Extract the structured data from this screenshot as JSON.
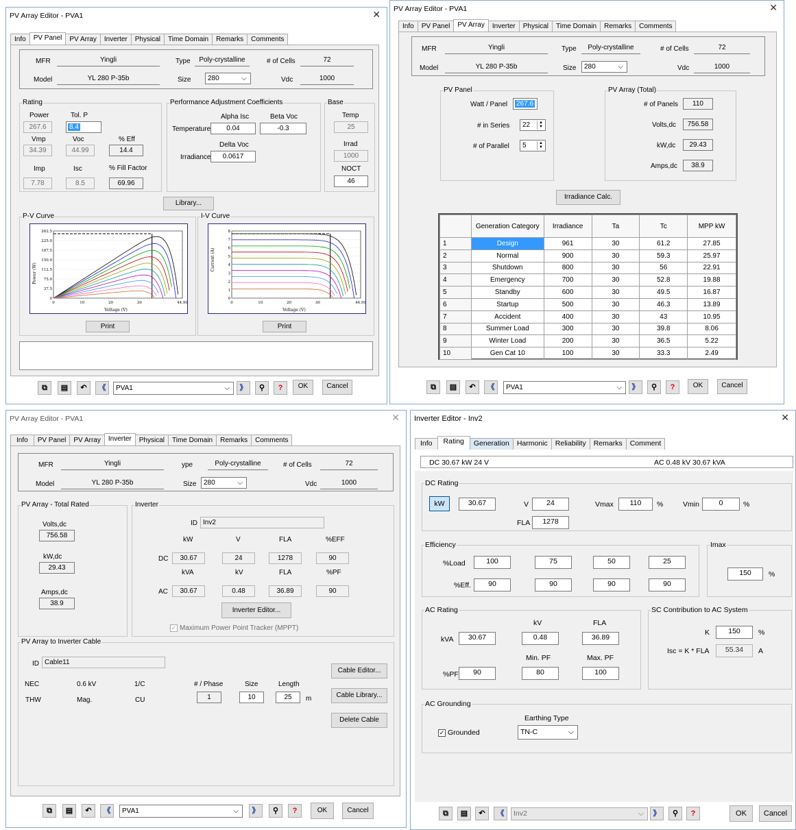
{
  "common": {
    "panel_tabs": [
      "Info",
      "PV Panel",
      "PV Array",
      "Inverter",
      "Physical",
      "Time Domain",
      "Remarks",
      "Comments"
    ],
    "close_symbol": "✕",
    "ok_label": "OK",
    "cancel_label": "Cancel",
    "pva_selector_value": "PVA1",
    "mfr_label": "MFR",
    "model_label": "Model",
    "type_label": "Type",
    "size_label": "Size",
    "cells_label": "# of Cells",
    "vdc_label": "Vdc",
    "mfr_value": "Yingli",
    "model_value": "YL 280 P-35b",
    "type_value": "Poly-crystalline",
    "size_value": "280",
    "cells_value": "72",
    "vdc_value": "1000"
  },
  "pv_panel_window": {
    "title": "PV Array Editor - PVA1",
    "active_tab": "PV Panel",
    "rating": {
      "group_label": "Rating",
      "power_label": "Power",
      "power_value": "267.6",
      "tolp_label": "Tol. P",
      "tolp_value": "8.4",
      "vmp_label": "Vmp",
      "vmp_value": "34.39",
      "voc_label": "Voc",
      "voc_value": "44.99",
      "eff_label": "% Eff",
      "eff_value": "14.4",
      "imp_label": "Imp",
      "imp_value": "7.78",
      "isc_label": "Isc",
      "isc_value": "8.5",
      "fill_label": "% Fill Factor",
      "fill_value": "69.96"
    },
    "pac": {
      "group_label": "Performance Adjustment Coefficients",
      "alpha_label": "Alpha Isc",
      "beta_label": "Beta Voc",
      "temperature_label": "Temperature",
      "alpha_value": "0.04",
      "beta_value": "-0.3",
      "delta_label": "Delta Voc",
      "irradiance_label": "Irradiance",
      "delta_value": "0.0617"
    },
    "base": {
      "group_label": "Base",
      "temp_label": "Temp",
      "temp_value": "25",
      "irrad_label": "Irrad",
      "irrad_value": "1000",
      "noct_label": "NOCT",
      "noct_value": "46"
    },
    "library_button": "Library...",
    "pv_curve": {
      "group_label": "P-V Curve",
      "y_label": "Power (W)",
      "x_label": "Voltage (V)",
      "y_ticks": [
        "262.5",
        "225.0",
        "187.5",
        "150.0",
        "112.5",
        "75.0",
        "37.5",
        "0"
      ],
      "x_ticks": [
        "0",
        "10",
        "20",
        "30",
        "44.99"
      ],
      "print_label": "Print"
    },
    "iv_curve": {
      "group_label": "I-V Curve",
      "y_label": "Current (A)",
      "x_label": "Voltage (V)",
      "y_ticks": [
        "8",
        "7",
        "6",
        "5",
        "4",
        "3",
        "2",
        "1",
        "0"
      ],
      "x_ticks": [
        "0",
        "10",
        "20",
        "30",
        "44.99"
      ],
      "print_label": "Print"
    }
  },
  "pv_array_window": {
    "title": "PV Array Editor - PVA1",
    "active_tab": "PV Array",
    "pv_panel": {
      "group_label": "PV Panel",
      "watt_label": "Watt / Panel",
      "watt_value": "267.6",
      "series_label": "# in Series",
      "series_value": "22",
      "parallel_label": "# of Parallel",
      "parallel_value": "5"
    },
    "pv_array_total": {
      "group_label": "PV Array (Total)",
      "panels_label": "# of Panels",
      "panels_value": "110",
      "volts_label": "Volts,dc",
      "volts_value": "756.58",
      "kw_label": "kW,dc",
      "kw_value": "29.43",
      "amps_label": "Amps,dc",
      "amps_value": "38.9"
    },
    "irradiance_button": "Irradiance Calc.",
    "table": {
      "columns": [
        "",
        "Generation Category",
        "Irradiance",
        "Ta",
        "Tc",
        "MPP kW"
      ],
      "rows": [
        [
          "1",
          "Design",
          "961",
          "30",
          "61.2",
          "27.85"
        ],
        [
          "2",
          "Normal",
          "900",
          "30",
          "59.3",
          "25.97"
        ],
        [
          "3",
          "Shutdown",
          "800",
          "30",
          "56",
          "22.91"
        ],
        [
          "4",
          "Emergency",
          "700",
          "30",
          "52.8",
          "19.88"
        ],
        [
          "5",
          "Standby",
          "600",
          "30",
          "49.5",
          "16.87"
        ],
        [
          "6",
          "Startup",
          "500",
          "30",
          "46.3",
          "13.89"
        ],
        [
          "7",
          "Accident",
          "400",
          "30",
          "43",
          "10.95"
        ],
        [
          "8",
          "Summer Load",
          "300",
          "30",
          "39.8",
          "8.06"
        ],
        [
          "9",
          "Winter Load",
          "200",
          "30",
          "36.5",
          "5.22"
        ],
        [
          "10",
          "Gen Cat 10",
          "100",
          "30",
          "33.3",
          "2.49"
        ]
      ]
    }
  },
  "pv_inverter_window": {
    "title": "PV Array Editor - PVA1",
    "active_tab": "Inverter",
    "total_rated": {
      "group_label": "PV Array - Total Rated",
      "volts_label": "Volts,dc",
      "volts_value": "756.58",
      "kw_label": "kW,dc",
      "kw_value": "29.43",
      "amps_label": "Amps,dc",
      "amps_value": "38.9"
    },
    "inverter": {
      "group_label": "Inverter",
      "id_label": "ID",
      "id_value": "Inv2",
      "dc_headers": [
        "kW",
        "V",
        "FLA",
        "%EFF"
      ],
      "dc_label": "DC",
      "dc_values": [
        "30.67",
        "24",
        "1278",
        "90"
      ],
      "ac_headers": [
        "kVA",
        "kV",
        "FLA",
        "%PF"
      ],
      "ac_label": "AC",
      "ac_values": [
        "30.67",
        "0.48",
        "36.89",
        "90"
      ],
      "editor_button": "Inverter Editor...",
      "mppt_label": "Maximum Power Point Tracker (MPPT)"
    },
    "cable": {
      "group_label": "PV Array to Inverter Cable",
      "id_label": "ID",
      "id_value": "Cable11",
      "nec": "NEC",
      "kv": "0.6 kV",
      "phase_code": "1/C",
      "thw": "THW",
      "mag": "Mag.",
      "cu": "CU",
      "phase_label": "# / Phase",
      "size_label": "Size",
      "length_label": "Length",
      "phase_value": "1",
      "size_value": "10",
      "length_value": "25",
      "length_unit": "m",
      "editor_button": "Cable Editor...",
      "library_button": "Cable Library...",
      "delete_button": "Delete Cable"
    }
  },
  "inverter_editor_window": {
    "title": "Inverter Editor - Inv2",
    "tabs": [
      "Info",
      "Rating",
      "Generation",
      "Harmonic",
      "Reliability",
      "Remarks",
      "Comment"
    ],
    "active_tab": "Rating",
    "summary_dc": "DC 30.67 kW   24 V",
    "summary_ac": "AC  0.48 kV   30.67 kVA",
    "dc_rating": {
      "group_label": "DC Rating",
      "kw_button": "kW",
      "kw_value": "30.67",
      "v_label": "V",
      "v_value": "24",
      "vmax_label": "Vmax",
      "vmax_value": "110",
      "vmax_unit": "%",
      "vmin_label": "Vmin",
      "vmin_value": "0",
      "vmin_unit": "%",
      "fla_label": "FLA",
      "fla_value": "1278"
    },
    "efficiency": {
      "group_label": "Efficiency",
      "load_label": "%Load",
      "load_values": [
        "100",
        "75",
        "50",
        "25"
      ],
      "eff_label": "%Eff.",
      "eff_values": [
        "90",
        "90",
        "90",
        "90"
      ]
    },
    "imax": {
      "group_label": "Imax",
      "value": "150",
      "unit": "%"
    },
    "ac_rating": {
      "group_label": "AC Rating",
      "kv_label": "kV",
      "fla_label": "FLA",
      "kva_label": "kVA",
      "kva_value": "30.67",
      "kv_value": "0.48",
      "fla_value": "36.89",
      "minpf_label": "Min. PF",
      "maxpf_label": "Max. PF",
      "pf_label": "%PF",
      "pf_value": "90",
      "minpf_value": "80",
      "maxpf_value": "100"
    },
    "sc_contribution": {
      "group_label": "SC Contribution to AC System",
      "k_label": "K",
      "k_value": "150",
      "k_unit": "%",
      "isc_label": "Isc = K * FLA",
      "isc_value": "55.34",
      "isc_unit": "A"
    },
    "ac_grounding": {
      "group_label": "AC Grounding",
      "grounded_label": "Grounded",
      "earthing_label": "Earthing Type",
      "earthing_value": "TN-C"
    },
    "selector_value": "Inv2",
    "ok_label": "OK",
    "cancel_label": "Cancel"
  }
}
